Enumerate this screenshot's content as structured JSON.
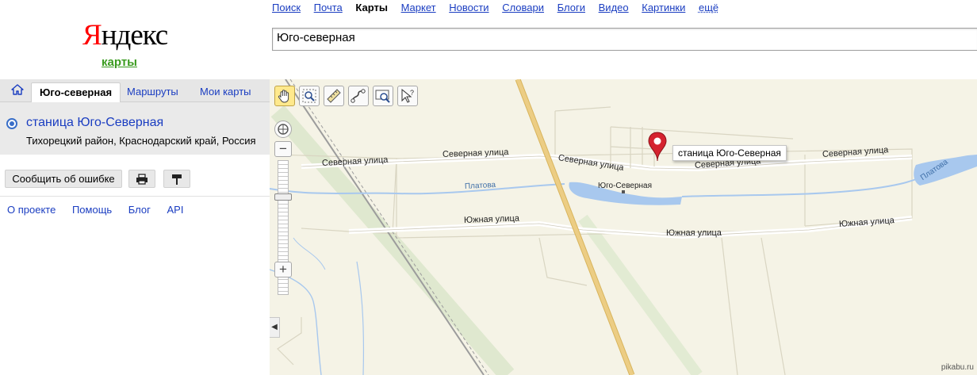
{
  "logo": {
    "word_first": "Я",
    "word_rest": "ндекс",
    "sub": "карты"
  },
  "services": [
    {
      "label": "Поиск",
      "active": false
    },
    {
      "label": "Почта",
      "active": false
    },
    {
      "label": "Карты",
      "active": true
    },
    {
      "label": "Маркет",
      "active": false
    },
    {
      "label": "Новости",
      "active": false
    },
    {
      "label": "Словари",
      "active": false
    },
    {
      "label": "Блоги",
      "active": false
    },
    {
      "label": "Видео",
      "active": false
    },
    {
      "label": "Картинки",
      "active": false
    },
    {
      "label": "ещё",
      "active": false
    }
  ],
  "search": {
    "value": "Юго-северная"
  },
  "tabs": {
    "home_icon": "home-icon",
    "search": "Юго-северная",
    "routes": "Маршруты",
    "mymaps": "Мои карты"
  },
  "result": {
    "title": "станица Юго-Северная",
    "address": "Тихорецкий район, Краснодарский край, Россия"
  },
  "actions": {
    "report": "Сообщить об ошибке",
    "print_icon": "printer-icon",
    "link_icon": "signpost-icon"
  },
  "footer": {
    "about": "О проекте",
    "help": "Помощь",
    "blog": "Блог",
    "api": "API"
  },
  "map": {
    "labels": {
      "sev1": "Северная улица",
      "sev2": "Северная улица",
      "sev3": "Северная улица",
      "sev4": "Северная улица",
      "sev5": "Северная улица",
      "river1": "Платова",
      "river2": "Платова",
      "settlement": "Юго-Северная",
      "yuzh1": "Южная улица",
      "yuzh2": "Южная улица",
      "yuzh3": "Южная улица"
    },
    "balloon": "станица Юго-Северная",
    "tools": [
      "hand-icon",
      "zoom-area-icon",
      "ruler-icon",
      "route-icon",
      "magnifier-icon",
      "pointer-help-icon"
    ],
    "zoom_level_fraction": 0.74
  },
  "watermark": "pikabu.ru",
  "colors": {
    "logo_red": "#ff0000",
    "link": "#1a3dc1",
    "sub_green": "#3a9b1f",
    "road_yellow": "#e9c77e",
    "water": "#a8c8ee",
    "marker": "#d5232f"
  }
}
